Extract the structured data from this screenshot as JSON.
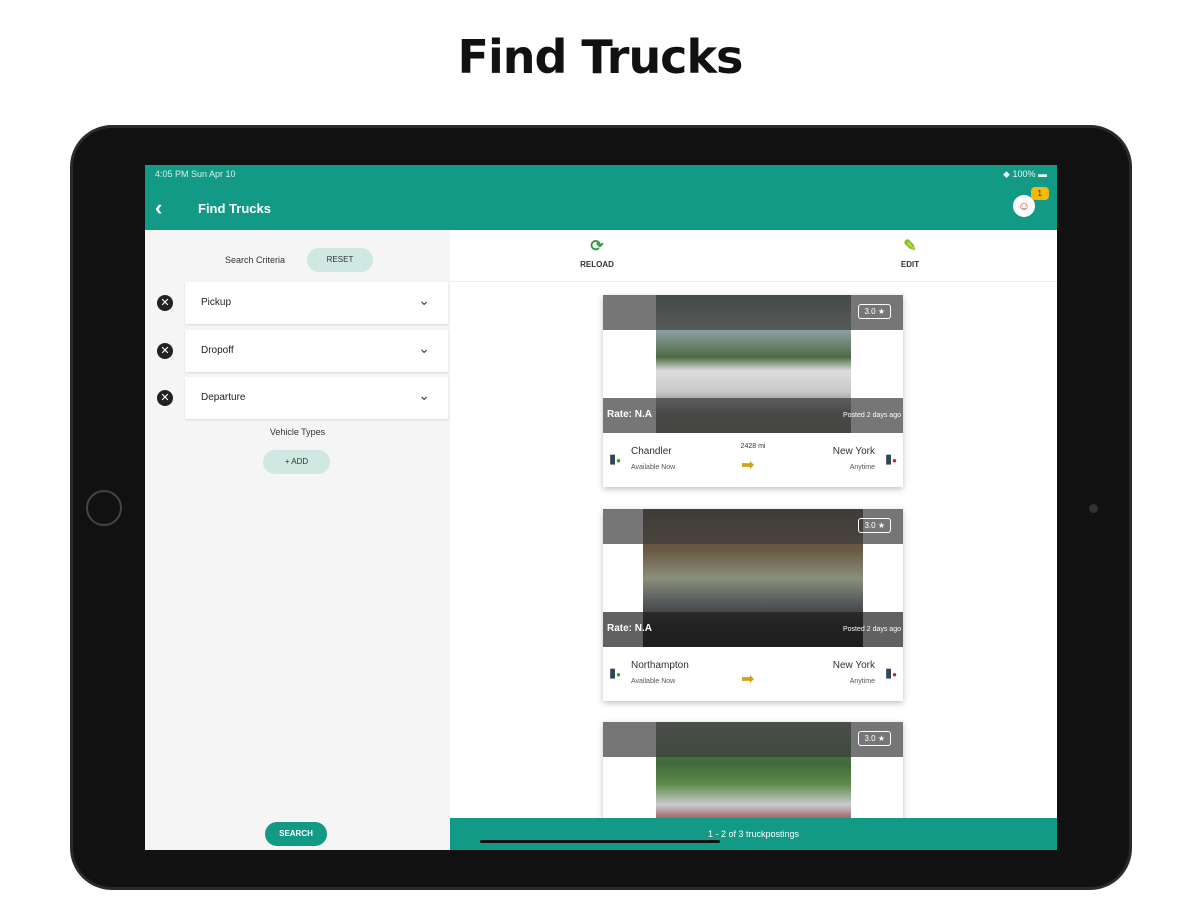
{
  "page_title": "Find Trucks",
  "status": {
    "time": "4:05 PM  Sun Apr 10",
    "battery": "100%"
  },
  "header": {
    "back": "‹",
    "title": "Find Trucks",
    "avatar": "☺",
    "badge": "1"
  },
  "left": {
    "criteria_label": "Search Criteria",
    "reset": "RESET",
    "filters": [
      {
        "label": "Pickup"
      },
      {
        "label": "Dropoff"
      },
      {
        "label": "Departure"
      }
    ],
    "vehicle_types": "Vehicle Types",
    "add": "+ ADD",
    "search": "SEARCH"
  },
  "toolbar": {
    "reload": "RELOAD",
    "edit": "EDIT"
  },
  "cards": [
    {
      "rating": "3.0 ★",
      "rate": "Rate: N.A",
      "posted": "Posted  2 days ago",
      "origin": "Chandler",
      "origin_sub": "Available Now",
      "distance": "2428 mi",
      "dest": "New York",
      "dest_sub": "Anytime"
    },
    {
      "rating": "3.0 ★",
      "rate": "Rate: N.A",
      "posted": "Posted  2 days ago",
      "origin": "Northampton",
      "origin_sub": "Available Now",
      "distance": "",
      "dest": "New York",
      "dest_sub": "Anytime"
    },
    {
      "rating": "3.0 ★"
    }
  ],
  "footer": "1 - 2 of 3 truckpostings"
}
